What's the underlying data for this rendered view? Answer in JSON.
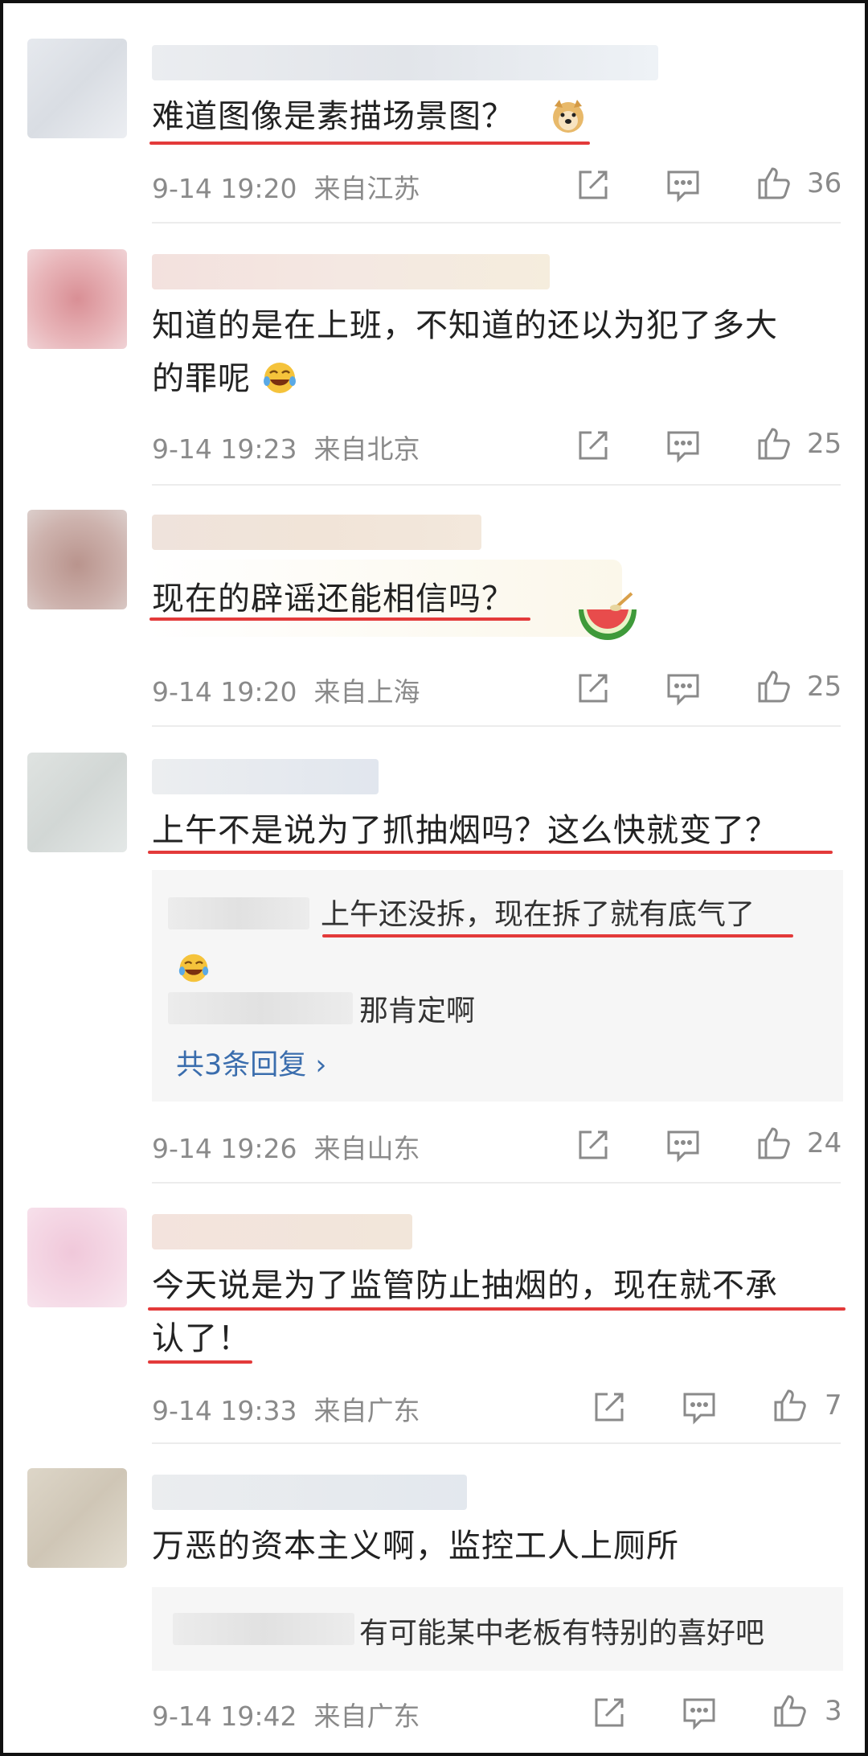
{
  "comments": [
    {
      "text_lines": [
        "难道图像是素描场景图？"
      ],
      "time": "9-14 19:20",
      "location": "来自江苏",
      "likes": "36",
      "emoji": "doge-emoji"
    },
    {
      "text_lines": [
        "知道的是在上班，不知道的还以为犯了多大",
        "的罪呢"
      ],
      "time": "9-14 19:23",
      "location": "来自北京",
      "likes": "25",
      "emoji": "laugh-cry-emoji"
    },
    {
      "text_lines": [
        "现在的辟谣还能相信吗？"
      ],
      "time": "9-14 19:20",
      "location": "来自上海",
      "likes": "25",
      "emoji": "watermelon-emoji"
    },
    {
      "text_lines": [
        "上午不是说为了抓抽烟吗？这么快就变了？"
      ],
      "time": "9-14 19:26",
      "location": "来自山东",
      "likes": "24",
      "replies": [
        {
          "text": "上午还没拆，现在拆了就有底气了"
        },
        {
          "text": "那肯定啊"
        }
      ],
      "more_replies": "共3条回复 ›"
    },
    {
      "text_lines": [
        "今天说是为了监管防止抽烟的，现在就不承",
        "认了！"
      ],
      "time": "9-14 19:33",
      "location": "来自广东",
      "likes": "7"
    },
    {
      "text_lines": [
        "万恶的资本主义啊，监控工人上厕所"
      ],
      "time": "9-14 19:42",
      "location": "来自广东",
      "likes": "3",
      "replies": [
        {
          "text": "有可能某中老板有特别的喜好吧"
        }
      ]
    }
  ],
  "icons": {
    "share": "share-icon",
    "reply": "comment-icon",
    "like": "thumbs-up-icon"
  },
  "colors": {
    "underline": "#e33a3a",
    "link": "#3a6dad",
    "meta": "#8a8a8a"
  }
}
